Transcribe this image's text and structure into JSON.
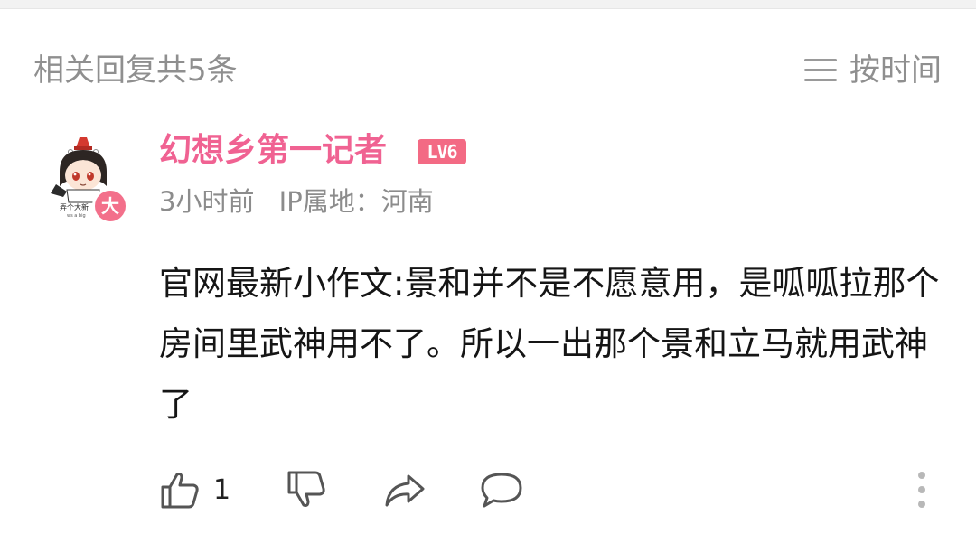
{
  "header": {
    "title": "相关回复共5条",
    "sort_label": "按时间",
    "sort_icon": "menu-lines-icon"
  },
  "comment": {
    "username": "幻想乡第一记者",
    "level_badge": "LV6",
    "avatar_badge": "大",
    "avatar_caption": "弄个大新",
    "time": "3小时前",
    "ip_location": "IP属地：河南",
    "content": "官网最新小作文:景和并不是不愿意用，是呱呱拉那个房间里武神用不了。所以一出那个景和立马就用武神了",
    "likes": "1"
  },
  "colors": {
    "username": "#f06292",
    "level_badge_bg": "#f36a84",
    "muted_text": "#8f8f8f",
    "icon_gray": "#555555"
  },
  "icons": [
    "thumbs-up-icon",
    "thumbs-down-icon",
    "share-icon",
    "comment-icon",
    "more-vertical-icon"
  ]
}
